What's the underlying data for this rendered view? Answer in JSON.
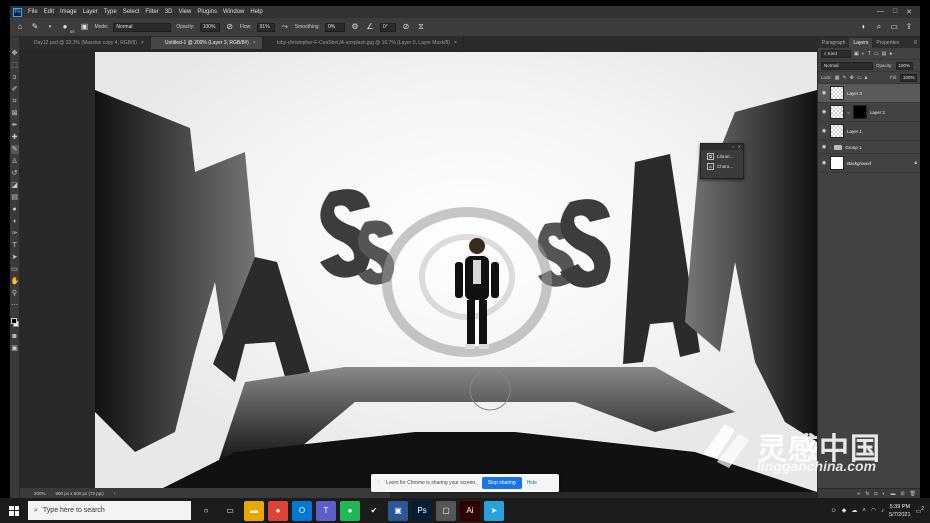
{
  "menubar": {
    "logo": "Ps",
    "items": [
      "File",
      "Edit",
      "Image",
      "Layer",
      "Type",
      "Select",
      "Filter",
      "3D",
      "View",
      "Plugins",
      "Window",
      "Help"
    ],
    "window_controls": [
      "—",
      "□",
      "✕"
    ]
  },
  "options": {
    "mode_label": "Mode:",
    "mode_value": "Normal",
    "opacity_label": "Opacity:",
    "opacity_value": "100%",
    "flow_label": "Flow:",
    "flow_value": "91%",
    "smoothing_label": "Smoothing:",
    "smoothing_value": "0%",
    "angle_value": "0°",
    "brush_size": "65"
  },
  "tabs": [
    {
      "label": "Day12.psd @ 33.3% (Massive copy 4, RGB/8)",
      "active": false
    },
    {
      "label": "Untitled-1 @ 200% (Layer 3, RGB/8#)",
      "active": true
    },
    {
      "label": "toby-christopher-F-CeaSbeUA-unsplash.jpg @ 16.7% (Layer 0, Layer Mask/8)",
      "active": false
    }
  ],
  "tab_close": "×",
  "mini_panel": {
    "items": [
      {
        "icon": "library-icon",
        "glyph": "⧉",
        "label": "Librari..."
      },
      {
        "icon": "character-icon",
        "glyph": "A",
        "label": "Chara..."
      }
    ]
  },
  "panels": {
    "tabs": [
      "Paragraph",
      "Layers",
      "Properties"
    ],
    "active_tab": "Layers",
    "kind_label": "Kind",
    "blend_mode": "Normal",
    "opacity_label": "Opacity:",
    "opacity_value": "100%",
    "lock_label": "Lock:",
    "fill_label": "Fill:",
    "fill_value": "100%",
    "layers": [
      {
        "name": "Layer 3",
        "thumb": "transparent",
        "visible": true,
        "selected": true,
        "italic": false,
        "locked": false
      },
      {
        "name": "Layer 2",
        "thumb": "mask",
        "visible": true,
        "selected": false,
        "italic": false,
        "locked": false
      },
      {
        "name": "Layer 1",
        "thumb": "transparent",
        "visible": true,
        "selected": false,
        "italic": false,
        "locked": false
      },
      {
        "name": "Group 1",
        "thumb": "folder",
        "visible": true,
        "selected": false,
        "italic": false,
        "locked": false
      },
      {
        "name": "Background",
        "thumb": "white",
        "visible": true,
        "selected": false,
        "italic": true,
        "locked": true
      }
    ],
    "bottom_icons": [
      "link-icon",
      "fx-icon",
      "mask-icon",
      "adjustment-icon",
      "folder-icon",
      "new-layer-icon",
      "trash-icon"
    ]
  },
  "statusbar": {
    "zoom": "200%",
    "doc_size": "900 px x 600 px (72 ppi)"
  },
  "loom": {
    "text": "Loom for Chrome is sharing your screen.",
    "stop_label": "Stop sharing",
    "hide_label": "Hide"
  },
  "watermark": {
    "cn": "灵感中国",
    "en": "lingganchina.com"
  },
  "taskbar": {
    "search_placeholder": "Type here to search",
    "apps": [
      {
        "name": "task-view",
        "glyph": "○",
        "color": "#1c1c1c"
      },
      {
        "name": "widgets",
        "glyph": "▭",
        "color": "#1c1c1c"
      },
      {
        "name": "file-explorer",
        "glyph": "▬",
        "color": "#e8a800"
      },
      {
        "name": "chrome",
        "glyph": "●",
        "color": "#db4437"
      },
      {
        "name": "outlook",
        "glyph": "O",
        "color": "#0078d4"
      },
      {
        "name": "teams",
        "glyph": "T",
        "color": "#5b5fc7"
      },
      {
        "name": "spotify",
        "glyph": "●",
        "color": "#1db954"
      },
      {
        "name": "tick-app",
        "glyph": "✔",
        "color": "#1c1c1c"
      },
      {
        "name": "monitor-app",
        "glyph": "▣",
        "color": "#2b5797"
      },
      {
        "name": "photoshop",
        "glyph": "Ps",
        "color": "#001e36"
      },
      {
        "name": "screen-app",
        "glyph": "▢",
        "color": "#555"
      },
      {
        "name": "illustrator",
        "glyph": "Ai",
        "color": "#330000"
      },
      {
        "name": "telegram",
        "glyph": "➤",
        "color": "#2aa1da"
      }
    ],
    "time": "5:39 PM",
    "date": "5/7/2021",
    "notification_count": "2"
  },
  "colors": {
    "ps_bg": "#535353",
    "panel_bg": "#424242",
    "accent_blue": "#1a73e8"
  }
}
